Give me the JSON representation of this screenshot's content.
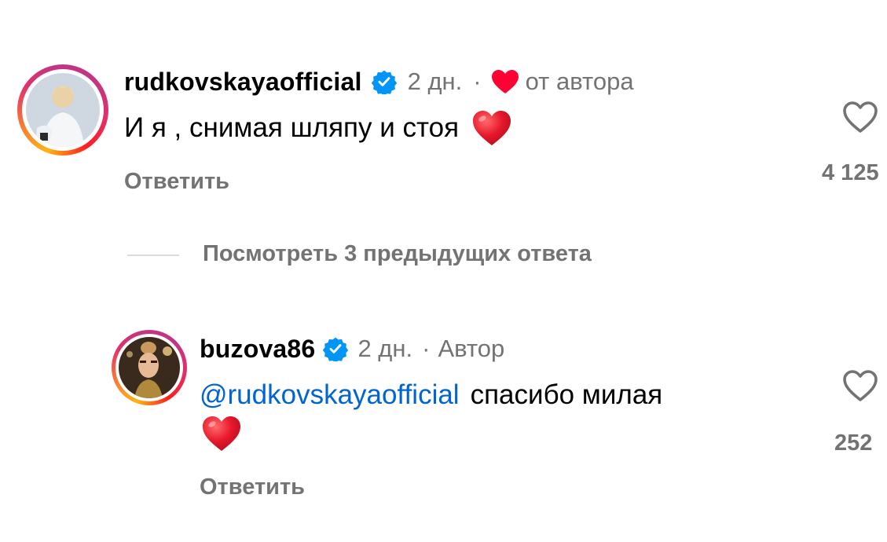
{
  "comment": {
    "username": "rudkovskaya",
    "username_suffix": "official",
    "time": "2 дн.",
    "separator": "·",
    "author_label": "от автора",
    "text": "И я , снимая шляпу и стоя",
    "emoji": "❤️",
    "reply_label": "Ответить",
    "like_count": "4 125"
  },
  "view_more": {
    "label": "Посмотреть 3 предыдущих ответа"
  },
  "reply": {
    "username": "buzova86",
    "time": "2 дн.",
    "separator": "·",
    "author_label": "Автор",
    "mention": "@rudkovskayaofficial",
    "text": "спасибо милая",
    "emoji": "❤️",
    "reply_label": "Ответить",
    "like_count": "252"
  },
  "colors": {
    "mention": "#0064d1",
    "verified": "#0095f6",
    "heart": "#ff0033",
    "secondary_text": "#737373"
  }
}
